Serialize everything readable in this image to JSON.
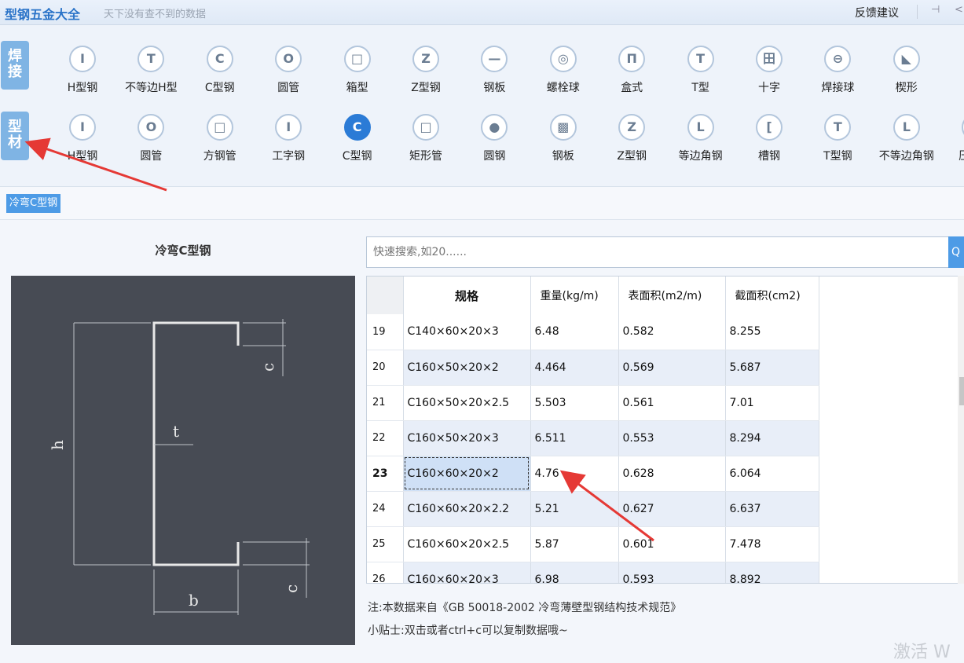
{
  "app": {
    "title": "型钢五金大全",
    "slogan": "天下没有查不到的数据",
    "feedback": "反馈建议",
    "pin_icon": "⊣",
    "more_icon": "<"
  },
  "categories": [
    {
      "label": "焊\n接"
    },
    {
      "label": "型\n材"
    }
  ],
  "weld_tools": [
    {
      "icon": "I",
      "label": "H型钢"
    },
    {
      "icon": "T",
      "label": "不等边H型"
    },
    {
      "icon": "C",
      "label": "C型钢"
    },
    {
      "icon": "O",
      "label": "圆管"
    },
    {
      "icon": "□",
      "label": "箱型"
    },
    {
      "icon": "Z",
      "label": "Z型钢"
    },
    {
      "icon": "—",
      "label": "钢板"
    },
    {
      "icon": "◎",
      "label": "螺栓球"
    },
    {
      "icon": "Π",
      "label": "盒式"
    },
    {
      "icon": "T",
      "label": "T型"
    },
    {
      "icon": "田",
      "label": "十字"
    },
    {
      "icon": "⊖",
      "label": "焊接球"
    },
    {
      "icon": "◣",
      "label": "楔形"
    }
  ],
  "profile_tools": [
    {
      "icon": "I",
      "label": "H型钢"
    },
    {
      "icon": "O",
      "label": "圆管"
    },
    {
      "icon": "□",
      "label": "方钢管"
    },
    {
      "icon": "I",
      "label": "工字钢"
    },
    {
      "icon": "C",
      "label": "C型钢"
    },
    {
      "icon": "□",
      "label": "矩形管"
    },
    {
      "icon": "●",
      "label": "圆钢"
    },
    {
      "icon": "▩",
      "label": "钢板"
    },
    {
      "icon": "Z",
      "label": "Z型钢"
    },
    {
      "icon": "L",
      "label": "等边角钢"
    },
    {
      "icon": "[",
      "label": "槽钢"
    },
    {
      "icon": "T",
      "label": "T型钢"
    },
    {
      "icon": "L",
      "label": "不等边角钢"
    },
    {
      "icon": "≋",
      "label": "压型钢"
    }
  ],
  "active_tab": "冷弯C型钢",
  "diagram": {
    "title": "冷弯C型钢",
    "labels": {
      "h": "h",
      "t": "t",
      "b": "b",
      "c_top": "c",
      "c_bottom": "c"
    }
  },
  "search": {
    "placeholder": "快速搜索,如20......",
    "icon": "Q"
  },
  "table": {
    "headers": [
      "规格",
      "重量(kg/m)",
      "表面积(m2/m)",
      "截面积(cm2)"
    ],
    "rows": [
      {
        "idx": "19",
        "spec": "C140×60×20×3",
        "weight": "6.48",
        "area_surface": "0.582",
        "area_section": "8.255"
      },
      {
        "idx": "20",
        "spec": "C160×50×20×2",
        "weight": "4.464",
        "area_surface": "0.569",
        "area_section": "5.687"
      },
      {
        "idx": "21",
        "spec": "C160×50×20×2.5",
        "weight": "5.503",
        "area_surface": "0.561",
        "area_section": "7.01"
      },
      {
        "idx": "22",
        "spec": "C160×50×20×3",
        "weight": "6.511",
        "area_surface": "0.553",
        "area_section": "8.294"
      },
      {
        "idx": "23",
        "spec": "C160×60×20×2",
        "weight": "4.76",
        "area_surface": "0.628",
        "area_section": "6.064"
      },
      {
        "idx": "24",
        "spec": "C160×60×20×2.2",
        "weight": "5.21",
        "area_surface": "0.627",
        "area_section": "6.637"
      },
      {
        "idx": "25",
        "spec": "C160×60×20×2.5",
        "weight": "5.87",
        "area_surface": "0.601",
        "area_section": "7.478"
      },
      {
        "idx": "26",
        "spec": "C160×60×20×3",
        "weight": "6.98",
        "area_surface": "0.593",
        "area_section": "8.892"
      }
    ]
  },
  "note": "注:本数据来自《GB 50018-2002 冷弯薄壁型钢结构技术规范》",
  "tip": "小贴士:双击或者ctrl+c可以复制数据哦~",
  "watermark": "激活 W",
  "colors": {
    "accent": "#2b7bd6",
    "annotation_arrow": "#e53935"
  }
}
